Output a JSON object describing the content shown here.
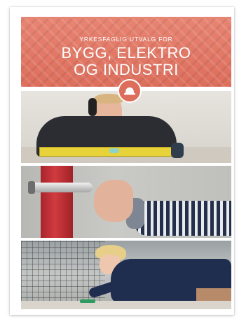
{
  "cover": {
    "kicker": "YRKESFAGLIG UTVALG FOR",
    "title_line1": "BYGG, ELEKTRO",
    "title_line2": "OG INDUSTRI"
  },
  "badge_icon": "hard-hat-icon",
  "photos": [
    {
      "name": "worker-with-spirit-level"
    },
    {
      "name": "hand-on-red-pipe-clamp"
    },
    {
      "name": "woman-working-at-bench"
    }
  ],
  "colors": {
    "banner": "#dd6e5c",
    "level": "#e8d23a",
    "pipe": "#c8343a"
  }
}
